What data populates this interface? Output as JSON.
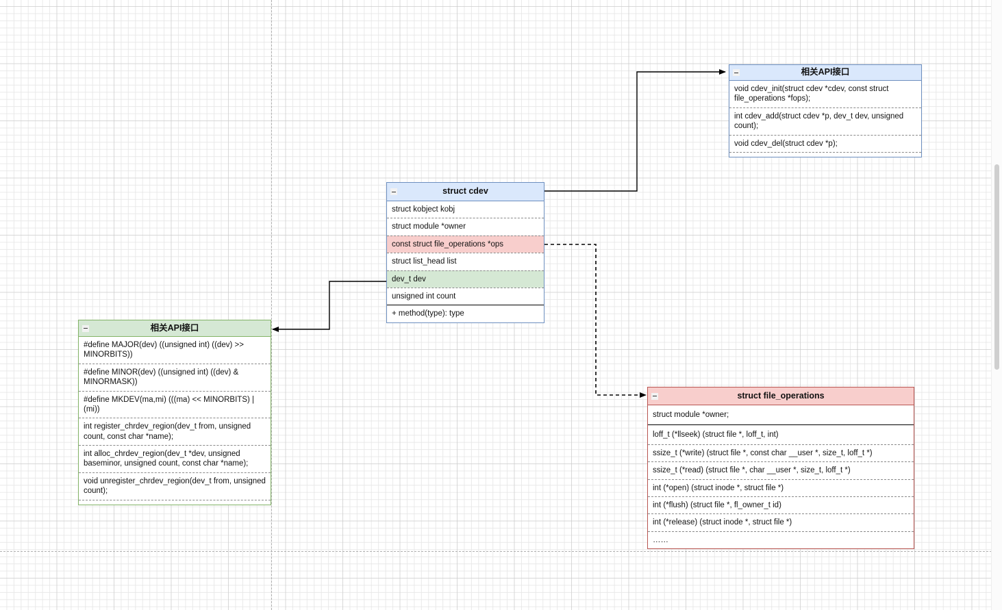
{
  "canvas": {
    "background_color": "#ffffff",
    "grid_minor_color": "#e6e6e6",
    "grid_major_color": "#c8c8c8",
    "page_break_color": "#b0b0b0"
  },
  "theme_colors": {
    "blue_fill": "#dae8fc",
    "blue_stroke": "#6c8ebf",
    "green_fill": "#d5e8d4",
    "green_stroke": "#82b366",
    "red_fill": "#f8cecc",
    "red_stroke": "#b85450",
    "edge": "#000000"
  },
  "collapse_icon": "minus-box-icon",
  "boxes": {
    "cdev": {
      "title": "struct cdev",
      "attributes": [
        "struct kobject kobj",
        "struct module *owner",
        "const struct file_operations *ops",
        "struct list_head list",
        "dev_t dev",
        "unsigned int count"
      ],
      "methods": [
        "+ method(type): type"
      ]
    },
    "cdev_api": {
      "title": "相关API接口",
      "rows": [
        "void cdev_init(struct cdev *cdev, const struct file_operations *fops);",
        "int cdev_add(struct cdev *p, dev_t dev, unsigned count);",
        "void cdev_del(struct cdev *p);"
      ]
    },
    "devt_api": {
      "title": "相关API接口",
      "rows": [
        "#define MAJOR(dev) ((unsigned int) ((dev) >> MINORBITS))",
        "#define MINOR(dev) ((unsigned int) ((dev) & MINORMASK))",
        "#define MKDEV(ma,mi) (((ma) << MINORBITS) | (mi))",
        "int register_chrdev_region(dev_t from, unsigned count, const char *name);",
        "int alloc_chrdev_region(dev_t *dev, unsigned baseminor, unsigned count, const char *name);",
        "void unregister_chrdev_region(dev_t from, unsigned count);"
      ]
    },
    "file_operations": {
      "title": "struct file_operations",
      "owner_row": "struct module *owner;",
      "rows": [
        "loff_t (*llseek) (struct file *, loff_t, int)",
        "ssize_t (*write) (struct file *, const char __user *, size_t, loff_t *)",
        "ssize_t (*read) (struct file *, char __user *, size_t, loff_t *)",
        "int (*open) (struct inode *, struct file *)",
        "int (*flush) (struct file *, fl_owner_t id)",
        "int (*release) (struct inode *, struct file *)",
        "……"
      ]
    }
  }
}
